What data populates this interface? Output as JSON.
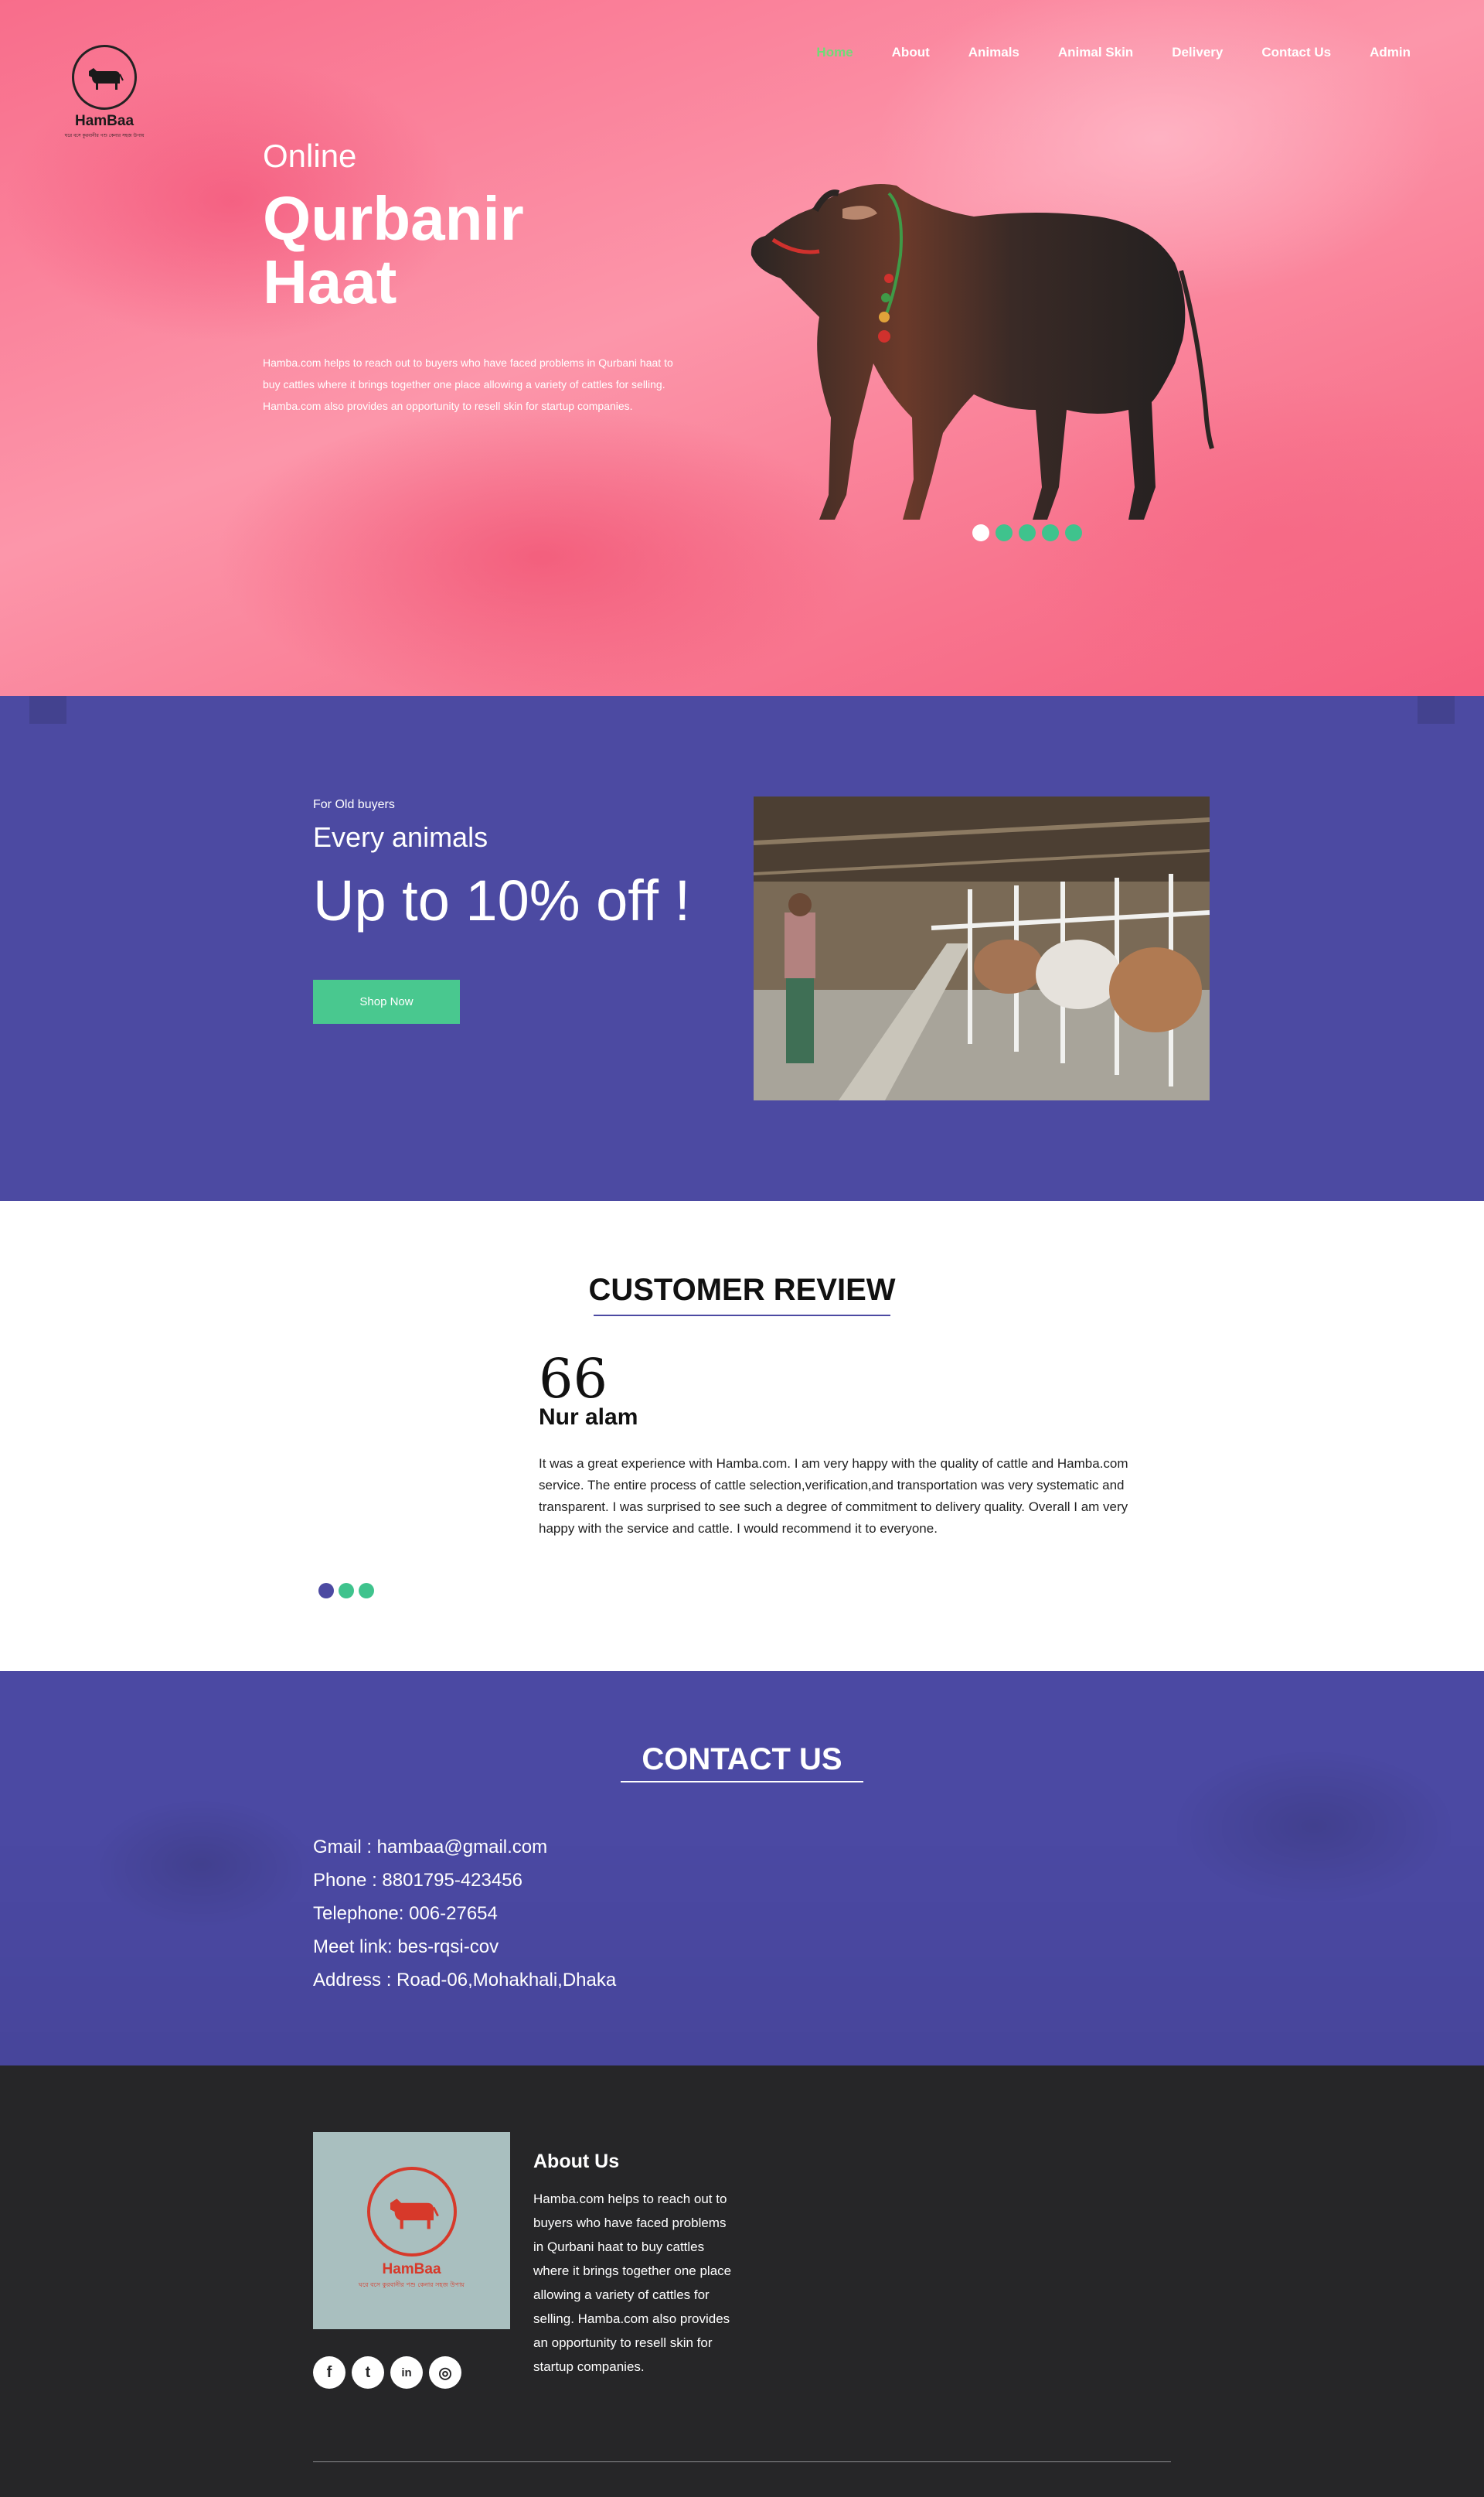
{
  "nav": {
    "logo_name": "HamBaa",
    "logo_tagline": "ঘরে বসে কুরবানীর পশু কেনার সহজ উপায়",
    "items": [
      {
        "label": "Home",
        "active": true
      },
      {
        "label": "About"
      },
      {
        "label": "Animals"
      },
      {
        "label": "Animal Skin"
      },
      {
        "label": "Delivery"
      },
      {
        "label": "Contact Us"
      },
      {
        "label": "Admin"
      }
    ]
  },
  "hero": {
    "subtitle": "Online",
    "title": "Qurbanir Haat",
    "description": "Hamba.com helps to reach out to buyers who have faced problems in Qurbani haat to buy cattles where it brings together one place allowing a variety of cattles for selling. Hamba.com also provides an opportunity to resell skin for startup companies.",
    "slider_count": 5,
    "slider_active_index": 0,
    "accent_color": "#3fc38d"
  },
  "offer": {
    "small": "For Old buyers",
    "mid": "Every animals",
    "big": "Up to 10% off !",
    "button": "Shop Now",
    "background": "#4c4aa2"
  },
  "review": {
    "title": "CUSTOMER REVIEW",
    "quote_mark": "66",
    "name": "Nur alam",
    "text": "It was a great experience with Hamba.com. I am very happy with the quality of cattle and Hamba.com service. The entire process of cattle selection,verification,and transportation was very systematic and transparent. I was surprised to see such a degree of commitment to delivery quality. Overall I am very happy with the service and cattle. I would recommend it to everyone.",
    "dots_count": 3,
    "dots_active_index": 0
  },
  "contact": {
    "title": "CONTACT US",
    "items": [
      "Gmail : hambaa@gmail.com",
      "Phone : 8801795-423456",
      "Telephone: 006-27654",
      "Meet link: bes-rqsi-cov",
      "Address : Road-06,Mohakhali,Dhaka"
    ]
  },
  "footer": {
    "logo_name": "HamBaa",
    "logo_tagline": "ঘরে বসে কুরবানীর পশু কেনার সহজ উপায়",
    "about_title": "About Us",
    "about_text": "Hamba.com helps to reach out to buyers who have faced problems in Qurbani haat to buy cattles where it brings together one place allowing a variety of cattles for selling. Hamba.com also provides an opportunity to resell skin for startup companies.",
    "socials": [
      {
        "icon": "facebook-icon",
        "glyph": "f"
      },
      {
        "icon": "twitter-icon",
        "glyph": "t"
      },
      {
        "icon": "linkedin-icon",
        "glyph": "in"
      },
      {
        "icon": "instagram-icon",
        "glyph": "◎"
      }
    ]
  }
}
